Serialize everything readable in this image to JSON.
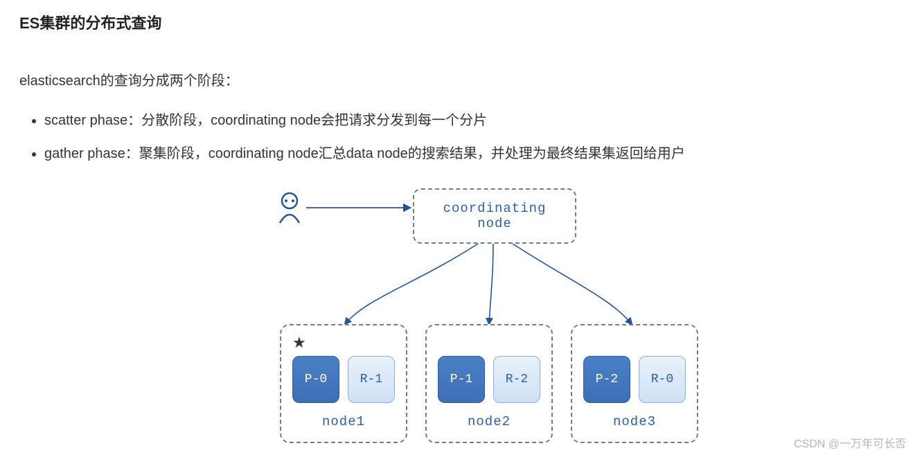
{
  "title": "ES集群的分布式查询",
  "intro": "elasticsearch的查询分成两个阶段：",
  "bullets": [
    "scatter phase：分散阶段，coordinating node会把请求分发到每一个分片",
    "gather phase：聚集阶段，coordinating node汇总data node的搜索结果，并处理为最终结果集返回给用户"
  ],
  "diagram": {
    "coordinating_label_line1": "coordinating",
    "coordinating_label_line2": "node",
    "nodes": [
      {
        "name": "node1",
        "primary": "P-0",
        "replica": "R-1",
        "is_master": true
      },
      {
        "name": "node2",
        "primary": "P-1",
        "replica": "R-2",
        "is_master": false
      },
      {
        "name": "node3",
        "primary": "P-2",
        "replica": "R-0",
        "is_master": false
      }
    ],
    "star": "★"
  },
  "watermark": "CSDN @一万年可长否",
  "colors": {
    "primary_shard": "#3e6fb6",
    "replica_shard": "#cfe0f5",
    "text_blue": "#2b5fa6",
    "dash_border": "#6f7c92",
    "arrow": "#22559c"
  }
}
